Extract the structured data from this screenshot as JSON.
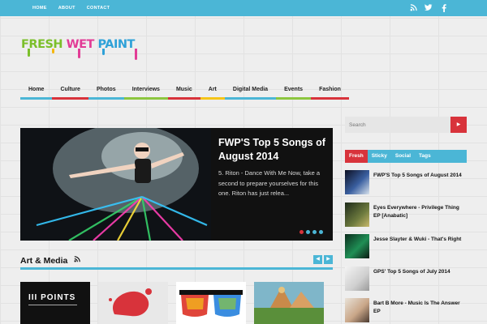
{
  "topbar": {
    "nav": [
      "HOME",
      "ABOUT",
      "CONTACT"
    ],
    "social": [
      "rss-icon",
      "twitter-icon",
      "facebook-icon"
    ]
  },
  "logo": {
    "words": [
      "FRESH",
      "WET",
      "PAINT"
    ]
  },
  "main_nav": [
    {
      "label": "Home",
      "color": "#4bb6d6"
    },
    {
      "label": "Culture",
      "color": "#d8333b"
    },
    {
      "label": "Photos",
      "color": "#4bb6d6"
    },
    {
      "label": "Interviews",
      "color": "#8cc63f"
    },
    {
      "label": "Music",
      "color": "#d8333b"
    },
    {
      "label": "Art",
      "color": "#f5c518"
    },
    {
      "label": "Digital Media",
      "color": "#4bb6d6"
    },
    {
      "label": "Events",
      "color": "#8cc63f"
    },
    {
      "label": "Fashion",
      "color": "#d8333b"
    }
  ],
  "slider": {
    "title": "FWP'S Top 5 Songs of August 2014",
    "excerpt": "5. Riton - Dance With Me Now, take a second to prepare yourselves for this one. Riton has just relea...",
    "dots": [
      "#d8333b",
      "#4bb6d6",
      "#4bb6d6",
      "#4bb6d6"
    ]
  },
  "section": {
    "title": "Art & Media",
    "prev": "◀",
    "next": "▶"
  },
  "search": {
    "placeholder": "Search",
    "button": "▶"
  },
  "tabs": [
    "Fresh",
    "Sticky",
    "Social",
    "Tags"
  ],
  "posts": [
    "FWP'S Top 5 Songs of August 2014",
    "Eyes Everywhere - Privilege Thing EP [Anabatic]",
    "Jesse Slayter & Wuki - That's Right",
    "GPS' Top 5 Songs of July 2014",
    "Bart B More - Music Is The Answer EP"
  ],
  "thumbs": [
    "III POINTS"
  ],
  "colors": {
    "accent": "#4bb6d6",
    "red": "#d8333b"
  }
}
